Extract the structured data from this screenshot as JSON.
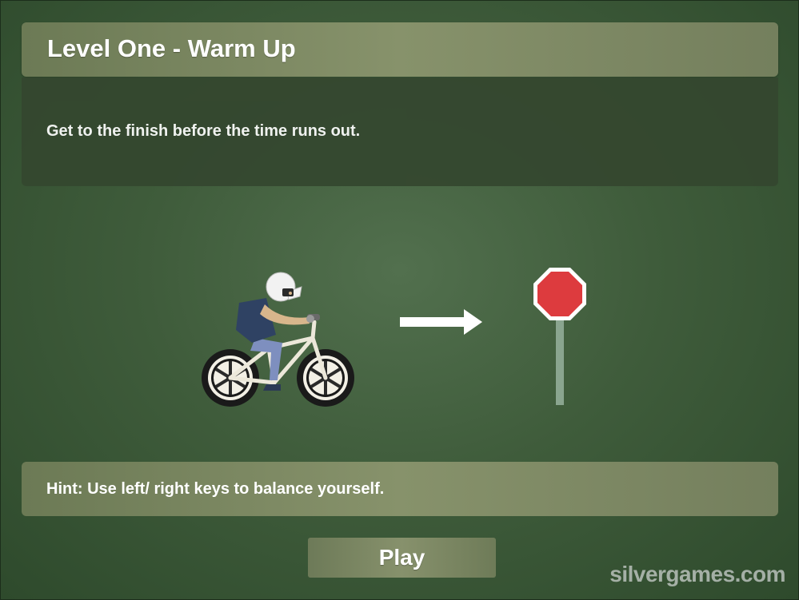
{
  "level": {
    "title": "Level One - Warm Up",
    "objective": "Get to the finish before the time runs out.",
    "hint": "Hint: Use left/ right keys to balance yourself."
  },
  "buttons": {
    "play_label": "Play"
  },
  "watermark": "silvergames.com",
  "colors": {
    "background": "#3f5c3b",
    "panel": "#7f8a64",
    "dark_panel": "#34472f",
    "stop_sign": "#dd3b3e",
    "text": "#ffffff"
  },
  "illustration": {
    "icons": [
      "bmx-rider-icon",
      "arrow-right-icon",
      "finish-stop-sign-icon"
    ]
  }
}
